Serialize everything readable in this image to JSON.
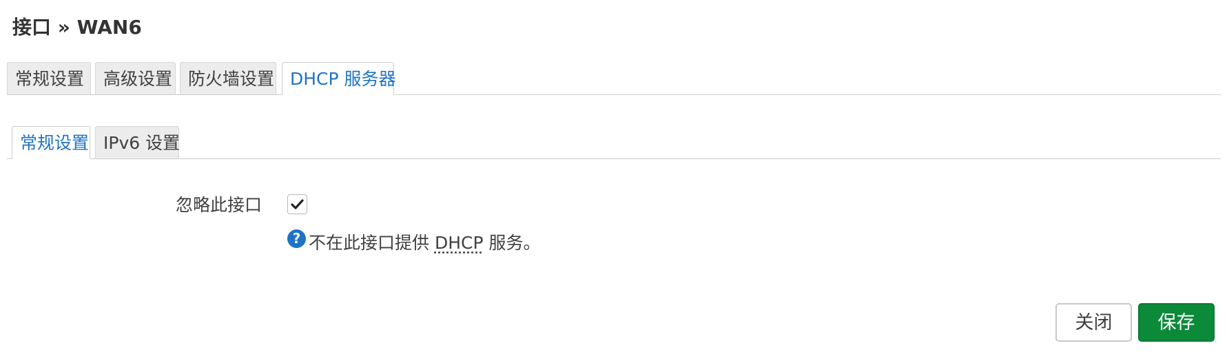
{
  "header": {
    "title": "接口 » WAN6"
  },
  "main_tabs": [
    {
      "label": "常规设置",
      "active": false
    },
    {
      "label": "高级设置",
      "active": false
    },
    {
      "label": "防火墙设置",
      "active": false
    },
    {
      "label": "DHCP 服务器",
      "active": true
    }
  ],
  "sub_tabs": [
    {
      "label": "常规设置",
      "active": true
    },
    {
      "label": "IPv6 设置",
      "active": false
    }
  ],
  "form": {
    "ignore_interface": {
      "label": "忽略此接口",
      "checked": true,
      "help_prefix": "不在此接口提供 ",
      "help_abbr": "DHCP",
      "help_suffix": " 服务。"
    }
  },
  "actions": {
    "close_label": "关闭",
    "save_label": "保存"
  },
  "colors": {
    "accent": "#1e73c4",
    "save_button": "#0b8a39"
  },
  "icons": {
    "help": "question-circle-icon",
    "check": "checkmark-icon"
  }
}
